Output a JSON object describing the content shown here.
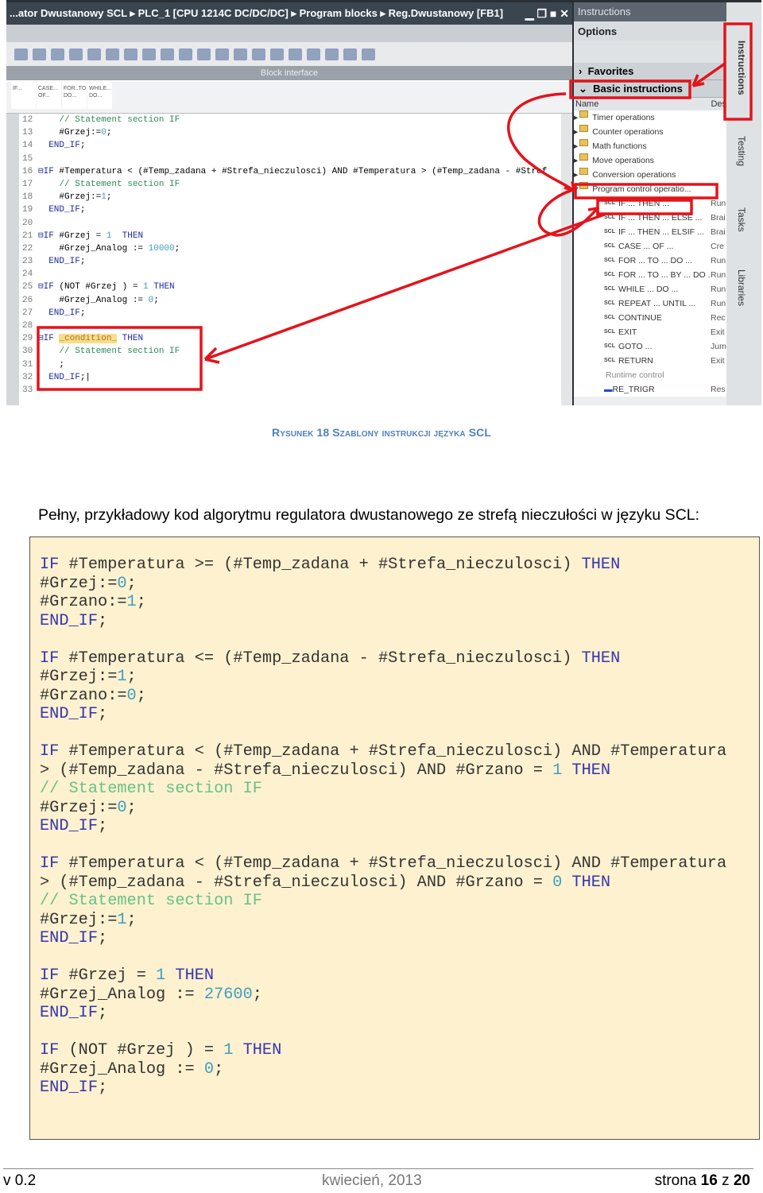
{
  "screenshot": {
    "title": "...ator Dwustanowy SCL ▸ PLC_1 [CPU 1214C DC/DC/DC] ▸ Program blocks ▸ Reg.Dwustanowy [FB1]",
    "window_buttons": "▁ ❐ ■ ✕",
    "block_interface": "Block interface",
    "snippets": [
      "IF...",
      "CASE... OF...",
      "FOR..TO DO...",
      "WHILE... DO..."
    ],
    "code_lines": [
      {
        "n": "12",
        "seg": [
          [
            "cm",
            "    // Statement section IF"
          ]
        ]
      },
      {
        "n": "13",
        "seg": [
          [
            "",
            "    #Grzej:="
          ],
          [
            "nm",
            "0"
          ],
          [
            "",
            ";"
          ]
        ]
      },
      {
        "n": "14",
        "seg": [
          [
            "kw",
            "  END_IF"
          ],
          [
            "",
            ";"
          ]
        ]
      },
      {
        "n": "15",
        "seg": []
      },
      {
        "n": "16",
        "seg": [
          [
            "kw",
            "⊟IF"
          ],
          [
            "",
            " #Temperatura < (#Temp_zadana + #Strefa_nieczulosci) AND #Temperatura > (#Temp_zadana - #Stref"
          ]
        ]
      },
      {
        "n": "17",
        "seg": [
          [
            "cm",
            "    // Statement section IF"
          ]
        ]
      },
      {
        "n": "18",
        "seg": [
          [
            "",
            "    #Grzej:="
          ],
          [
            "nm",
            "1"
          ],
          [
            "",
            ";"
          ]
        ]
      },
      {
        "n": "19",
        "seg": [
          [
            "kw",
            "  END_IF"
          ],
          [
            "",
            ";"
          ]
        ]
      },
      {
        "n": "20",
        "seg": []
      },
      {
        "n": "21",
        "seg": [
          [
            "kw",
            "⊟IF"
          ],
          [
            "",
            " #Grzej = "
          ],
          [
            "nm",
            "1"
          ],
          [
            "kw",
            "  THEN"
          ]
        ]
      },
      {
        "n": "22",
        "seg": [
          [
            "",
            "    #Grzej_Analog := "
          ],
          [
            "nm",
            "10000"
          ],
          [
            "",
            ";"
          ]
        ]
      },
      {
        "n": "23",
        "seg": [
          [
            "kw",
            "  END_IF"
          ],
          [
            "",
            ";"
          ]
        ]
      },
      {
        "n": "24",
        "seg": []
      },
      {
        "n": "25",
        "seg": [
          [
            "kw",
            "⊟IF"
          ],
          [
            "",
            " (NOT #Grzej ) = "
          ],
          [
            "nm",
            "1"
          ],
          [
            "kw",
            " THEN"
          ]
        ]
      },
      {
        "n": "26",
        "seg": [
          [
            "",
            "    #Grzej_Analog := "
          ],
          [
            "nm",
            "0"
          ],
          [
            "",
            ";"
          ]
        ]
      },
      {
        "n": "27",
        "seg": [
          [
            "kw",
            "  END_IF"
          ],
          [
            "",
            ";"
          ]
        ]
      },
      {
        "n": "28",
        "seg": []
      },
      {
        "n": "29",
        "seg": [
          [
            "kw",
            "⊟IF"
          ],
          [
            "",
            " "
          ],
          [
            "hl",
            "_condition_"
          ],
          [
            "kw",
            " THEN"
          ]
        ]
      },
      {
        "n": "30",
        "seg": [
          [
            "cm",
            "    // Statement section IF"
          ]
        ]
      },
      {
        "n": "31",
        "seg": [
          [
            "",
            "    ;"
          ]
        ]
      },
      {
        "n": "32",
        "seg": [
          [
            "kw",
            "  END_IF"
          ],
          [
            "",
            ";|"
          ]
        ]
      },
      {
        "n": "33",
        "seg": []
      }
    ],
    "instructions_panel": {
      "title": "Instructions",
      "options": "Options",
      "favorites": "Favorites",
      "basic": "Basic instructions",
      "col_name": "Name",
      "col_desc": "Des",
      "folders": [
        "Timer operations",
        "Counter operations",
        "Math functions",
        "Move operations",
        "Conversion operations",
        "Program control operatio..."
      ],
      "items": [
        {
          "name": "IF ... THEN ...",
          "desc": "Run"
        },
        {
          "name": "IF ... THEN ... ELSE ...",
          "desc": "Brai"
        },
        {
          "name": "IF ... THEN ... ELSIF ...",
          "desc": "Brai"
        },
        {
          "name": "CASE ... OF ...",
          "desc": "Cre"
        },
        {
          "name": "FOR ... TO ... DO ...",
          "desc": "Run"
        },
        {
          "name": "FOR ... TO ... BY ... DO ...",
          "desc": "Run"
        },
        {
          "name": "WHILE ... DO ...",
          "desc": "Run"
        },
        {
          "name": "REPEAT ... UNTIL ...",
          "desc": "Run"
        },
        {
          "name": "CONTINUE",
          "desc": "Rec"
        },
        {
          "name": "EXIT",
          "desc": "Exit"
        },
        {
          "name": "GOTO ...",
          "desc": "Jum"
        },
        {
          "name": "RETURN",
          "desc": "Exit"
        }
      ],
      "scl_tag": "SCL",
      "runtime_control": "Runtime control",
      "re_trigr": "RE_TRIGR",
      "re_trigr_desc": "Res"
    },
    "side_tabs": [
      "Instructions",
      "Testing",
      "Tasks",
      "Libraries"
    ],
    "annotation_color": "#e3141b"
  },
  "caption": "Rysunek 18 Szablony instrukcji języka SCL",
  "intro": "Pełny, przykładowy kod algorytmu regulatora dwustanowego ze strefą nieczułości w języku SCL:",
  "code_block": [
    [
      [
        "kw",
        "IF"
      ],
      [
        "",
        " #Temperatura >= (#Temp_zadana + #Strefa_nieczulosci) "
      ],
      [
        "kw",
        "THEN"
      ]
    ],
    [
      [
        "",
        "#Grzej:="
      ],
      [
        "nm",
        "0"
      ],
      [
        "",
        ";"
      ]
    ],
    [
      [
        "",
        "#Grzano:="
      ],
      [
        "nm",
        "1"
      ],
      [
        "",
        ";"
      ]
    ],
    [
      [
        "kw",
        "END_IF"
      ],
      [
        "",
        ";"
      ]
    ],
    [],
    [
      [
        "kw",
        "IF"
      ],
      [
        "",
        " #Temperatura <= (#Temp_zadana - #Strefa_nieczulosci) "
      ],
      [
        "kw",
        "THEN"
      ]
    ],
    [
      [
        "",
        "#Grzej:="
      ],
      [
        "nm",
        "1"
      ],
      [
        "",
        ";"
      ]
    ],
    [
      [
        "",
        "#Grzano:="
      ],
      [
        "nm",
        "0"
      ],
      [
        "",
        ";"
      ]
    ],
    [
      [
        "kw",
        "END_IF"
      ],
      [
        "",
        ";"
      ]
    ],
    [],
    [
      [
        "kw",
        "IF"
      ],
      [
        "",
        " #Temperatura < (#Temp_zadana + #Strefa_nieczulosci) AND #Temperatura"
      ]
    ],
    [
      [
        "",
        "> (#Temp_zadana - #Strefa_nieczulosci) AND #Grzano = "
      ],
      [
        "nm",
        "1"
      ],
      [
        "",
        " "
      ],
      [
        "kw",
        "THEN"
      ]
    ],
    [
      [
        "cm",
        "// Statement section IF"
      ]
    ],
    [
      [
        "",
        "#Grzej:="
      ],
      [
        "nm",
        "0"
      ],
      [
        "",
        ";"
      ]
    ],
    [
      [
        "kw",
        "END_IF"
      ],
      [
        "",
        ";"
      ]
    ],
    [],
    [
      [
        "kw",
        "IF"
      ],
      [
        "",
        " #Temperatura < (#Temp_zadana + #Strefa_nieczulosci) AND #Temperatura"
      ]
    ],
    [
      [
        "",
        "> (#Temp_zadana - #Strefa_nieczulosci) AND #Grzano = "
      ],
      [
        "nm",
        "0"
      ],
      [
        "",
        " "
      ],
      [
        "kw",
        "THEN"
      ]
    ],
    [
      [
        "cm",
        "// Statement section IF"
      ]
    ],
    [
      [
        "",
        "#Grzej:="
      ],
      [
        "nm",
        "1"
      ],
      [
        "",
        ";"
      ]
    ],
    [
      [
        "kw",
        "END_IF"
      ],
      [
        "",
        ";"
      ]
    ],
    [],
    [
      [
        "kw",
        "IF"
      ],
      [
        "",
        " #Grzej = "
      ],
      [
        "nm",
        "1"
      ],
      [
        "",
        " "
      ],
      [
        "kw",
        "THEN"
      ]
    ],
    [
      [
        "",
        "#Grzej_Analog := "
      ],
      [
        "nm",
        "27600"
      ],
      [
        "",
        ";"
      ]
    ],
    [
      [
        "kw",
        "END_IF"
      ],
      [
        "",
        ";"
      ]
    ],
    [],
    [
      [
        "kw",
        "IF"
      ],
      [
        "",
        " (NOT #Grzej ) = "
      ],
      [
        "nm",
        "1"
      ],
      [
        "",
        " "
      ],
      [
        "kw",
        "THEN"
      ]
    ],
    [
      [
        "",
        "#Grzej_Analog := "
      ],
      [
        "nm",
        "0"
      ],
      [
        "",
        ";"
      ]
    ],
    [
      [
        "kw",
        "END_IF"
      ],
      [
        "",
        ";"
      ]
    ]
  ],
  "footer": {
    "version": "v 0.2",
    "date": "kwiecień, 2013",
    "page_prefix": "strona ",
    "page": "16",
    "page_sep": " z ",
    "page_total": "20"
  }
}
